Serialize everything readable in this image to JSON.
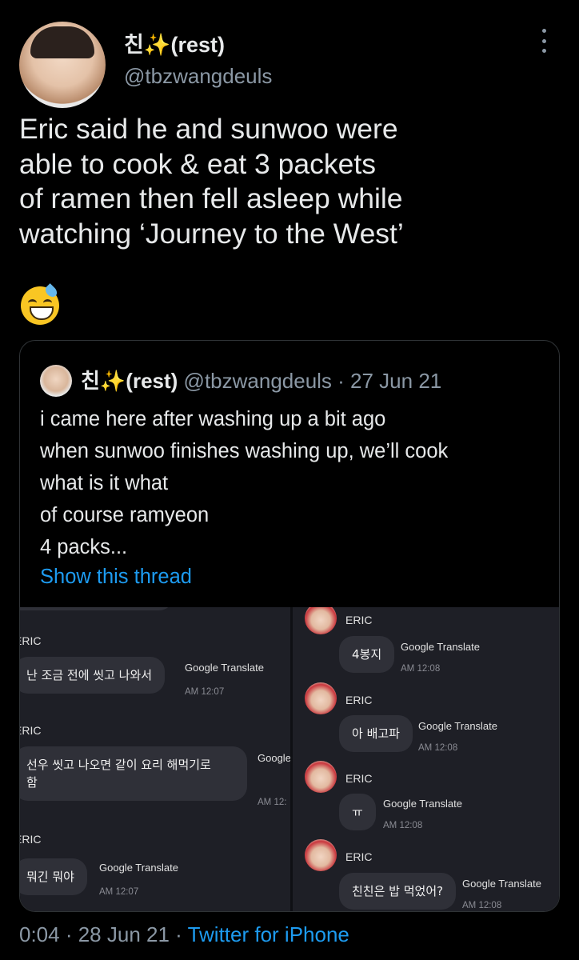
{
  "author": {
    "name": "친✨(rest)",
    "handle": "@tbzwangdeuls"
  },
  "tweet": {
    "text": "Eric said he and sunwoo were\nable to cook & eat 3 packets\nof ramen then fell asleep while\nwatching  ‘Journey to the West’"
  },
  "quote": {
    "name": "친✨(rest)",
    "meta": "@tbzwangdeuls · 27 Jun 21",
    "text": "i came here after washing up a bit ago\nwhen sunwoo finishes washing up, we’ll cook\nwhat is it what\nof course ramyeon\n4 packs...",
    "show_thread": "Show this thread"
  },
  "screenshot_left": {
    "sender": "ERIC",
    "messages": [
      {
        "text": "난 조금 전에 씻고 나와서",
        "translate": "Google Translate",
        "time": "AM 12:07"
      },
      {
        "text": "선우 씻고 나오면 같이 요리 해먹기로\n함",
        "translate": "Google",
        "time": "AM 12:"
      },
      {
        "text": "뭐긴 뭐야",
        "translate": "Google Translate",
        "time": "AM 12:07"
      }
    ]
  },
  "screenshot_right": {
    "sender": "ERIC",
    "messages": [
      {
        "text": "4봉지",
        "translate": "Google Translate",
        "time": "AM 12:08"
      },
      {
        "text": "아 배고파",
        "translate": "Google Translate",
        "time": "AM 12:08"
      },
      {
        "text": "ㅠ",
        "translate": "Google Translate",
        "time": "AM 12:08"
      },
      {
        "text": "친친은 밥 먹었어?",
        "translate": "Google Translate",
        "time": "AM 12:08"
      }
    ]
  },
  "footer": {
    "time": "0:04 · 28 Jun 21 · ",
    "client": "Twitter for iPhone"
  }
}
